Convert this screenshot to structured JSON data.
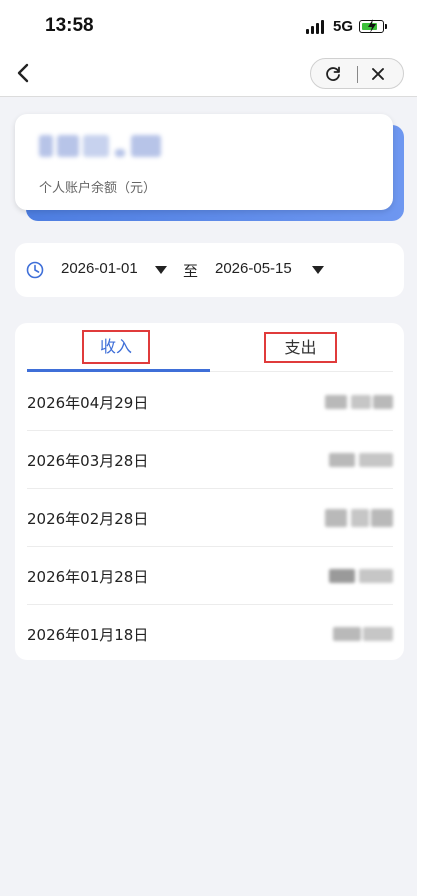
{
  "status_bar": {
    "time": "13:58",
    "network": "5G"
  },
  "balance": {
    "label": "个人账户余额（元）"
  },
  "date_filter": {
    "start": "2026-01-01",
    "separator": "至",
    "end": "2026-05-15"
  },
  "tabs": [
    {
      "label": "收入",
      "active": true
    },
    {
      "label": "支出",
      "active": false
    }
  ],
  "records": [
    {
      "date": "2026年04月29日"
    },
    {
      "date": "2026年03月28日"
    },
    {
      "date": "2026年02月28日"
    },
    {
      "date": "2026年01月28日"
    },
    {
      "date": "2026年01月18日"
    }
  ],
  "colors": {
    "accent": "#3f6fd8",
    "highlight_box": "#e03b3b",
    "battery": "#3cc13b",
    "background": "#f2f3f7"
  }
}
